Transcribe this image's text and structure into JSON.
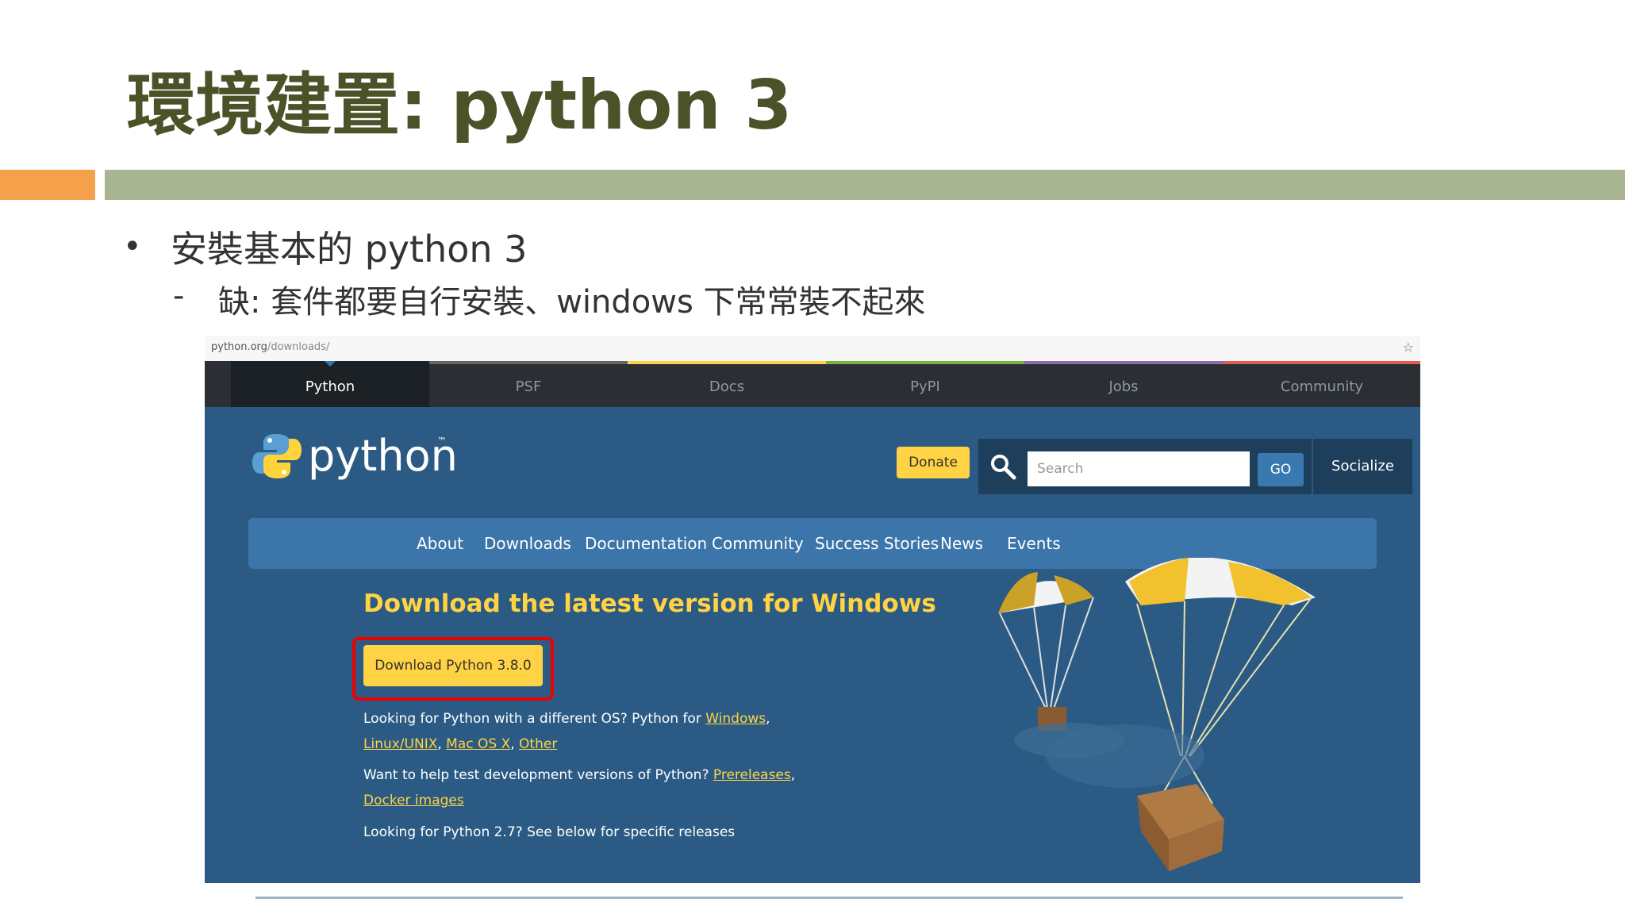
{
  "slide": {
    "title": "環境建置: python 3",
    "bullet": "安裝基本的 python 3",
    "sub_bullet": "缺: 套件都要自行安裝、windows 下常常裝不起來",
    "bullet_marker": "•",
    "sub_marker": "-"
  },
  "browser": {
    "url_host": "python.org",
    "url_path": "/downloads/"
  },
  "topnav": {
    "items": [
      "Python",
      "PSF",
      "Docs",
      "PyPI",
      "Jobs",
      "Community"
    ],
    "accent_colors": [
      "#3776ab",
      "#646565",
      "#ffd343",
      "#79b23f",
      "#8c6bb1",
      "#e05d52"
    ]
  },
  "header": {
    "logo_text": "python",
    "logo_tm": "™",
    "donate_label": "Donate",
    "search_placeholder": "Search",
    "go_label": "GO",
    "socialize_label": "Socialize"
  },
  "mainnav": {
    "items": [
      "About",
      "Downloads",
      "Documentation",
      "Community",
      "Success Stories",
      "News",
      "Events"
    ]
  },
  "download": {
    "heading": "Download the latest version for Windows",
    "button_label": "Download Python 3.8.0",
    "line1_prefix": "Looking for Python with a different OS? Python for ",
    "link_windows": "Windows",
    "link_linux": "Linux/UNIX",
    "link_mac": "Mac OS X",
    "link_other": "Other",
    "line3_prefix": "Want to help test development versions of Python? ",
    "link_prereleases": "Prereleases",
    "link_docker": "Docker images",
    "line5": "Looking for Python 2.7? See below for specific releases"
  },
  "colors": {
    "title": "#4a5228",
    "orange_bar": "#f5a04a",
    "green_bar": "#a8b590",
    "hero_bg": "#2b5b84",
    "yellow": "#ffd343"
  }
}
